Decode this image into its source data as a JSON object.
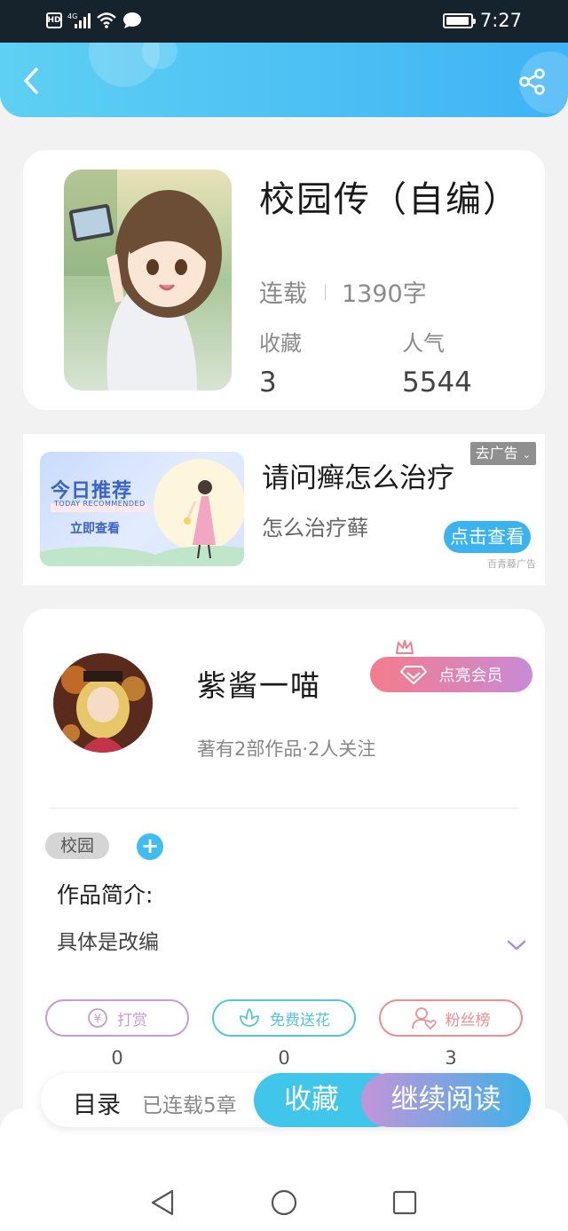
{
  "status_bar": {
    "hd": "HD",
    "network": "4G",
    "time": "7:27",
    "icons": [
      "hd-icon",
      "signal-icon",
      "wifi-icon",
      "message-icon",
      "battery-icon"
    ]
  },
  "header": {
    "back_icon": "chevron-left-icon",
    "share_icon": "share-icon"
  },
  "book": {
    "title": "校园传（自编）",
    "status": "连载",
    "word_count": "1390字",
    "favorites_label": "收藏",
    "favorites_value": "3",
    "popularity_label": "人气",
    "popularity_value": "5544"
  },
  "ad": {
    "image_title": "今日推荐",
    "image_sub": "TODAY RECOMMENDED",
    "image_cta": "立即查看",
    "title": "请问癣怎么治疗",
    "subtitle": "怎么治疗藓",
    "close_label": "去广告",
    "cta": "点击查看",
    "source": "百青藤广告"
  },
  "author": {
    "name": "紫酱一喵",
    "vip_button": "点亮会员",
    "meta": "著有2部作品·2人关注"
  },
  "tags": [
    "校园"
  ],
  "intro": {
    "label": "作品简介:",
    "text": "具体是改编"
  },
  "actions": [
    {
      "label": "打赏",
      "icon": "yen-coin-icon",
      "count": "0",
      "color": "#c49ad8"
    },
    {
      "label": "免费送花",
      "icon": "flower-icon",
      "count": "0",
      "color": "#52c6dc"
    },
    {
      "label": "粉丝榜",
      "icon": "fans-rank-icon",
      "count": "3",
      "color": "#ee8d8d"
    }
  ],
  "bottom_bar": {
    "toc_label": "目录",
    "toc_count": "已连载5章",
    "collect": "收藏",
    "continue_reading": "继续阅读"
  },
  "nav": {
    "icons": [
      "back-triangle-icon",
      "home-circle-icon",
      "recents-square-icon"
    ]
  }
}
